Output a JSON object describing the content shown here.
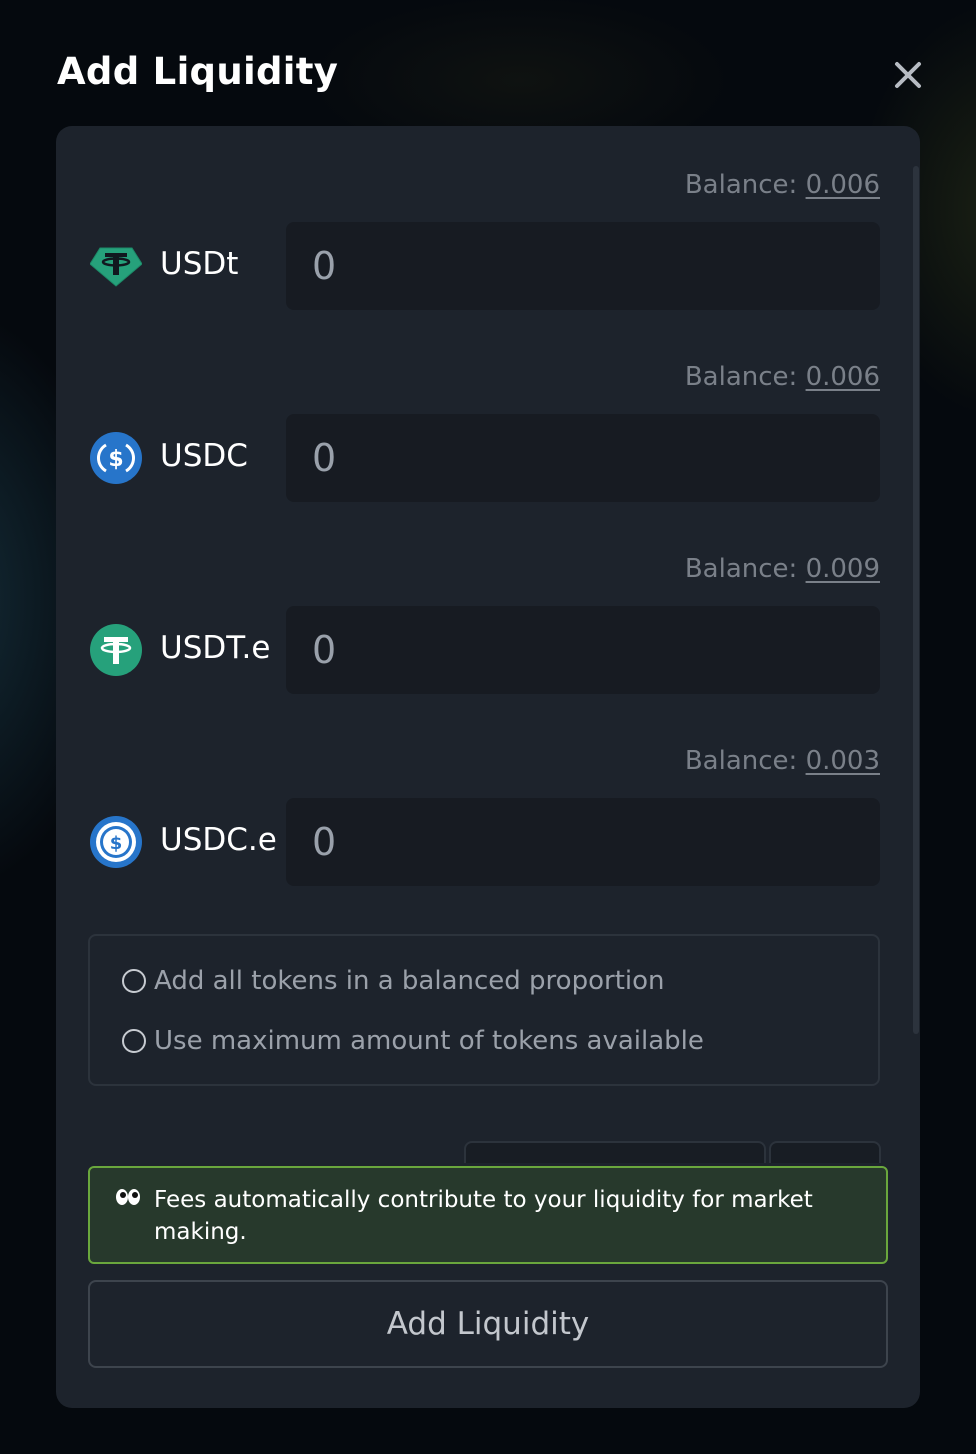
{
  "modal": {
    "title": "Add Liquidity",
    "close_icon": "close-icon"
  },
  "tokens": [
    {
      "symbol": "USDt",
      "balance_label": "Balance:",
      "balance": "0.006",
      "amount": "0",
      "icon": "tether-diamond-icon"
    },
    {
      "symbol": "USDC",
      "balance_label": "Balance:",
      "balance": "0.006",
      "amount": "0",
      "icon": "usdc-icon"
    },
    {
      "symbol": "USDT.e",
      "balance_label": "Balance:",
      "balance": "0.009",
      "amount": "0",
      "icon": "tether-icon"
    },
    {
      "symbol": "USDC.e",
      "balance_label": "Balance:",
      "balance": "0.003",
      "amount": "0",
      "icon": "usdc-bridged-icon"
    }
  ],
  "options": [
    {
      "label": "Add all tokens in a balanced proportion",
      "selected": false
    },
    {
      "label": "Use maximum amount of tokens available",
      "selected": false
    }
  ],
  "info": {
    "icon": "eyes-icon",
    "text": "Fees automatically contribute to your liquidity for market making."
  },
  "submit": {
    "label": "Add Liquidity"
  },
  "colors": {
    "card": "#1d232c",
    "input": "#171b22",
    "tether_teal": "#26a17b",
    "usdc_blue": "#2775ca",
    "info_border": "#6aa73d",
    "info_bg": "#27392c"
  }
}
